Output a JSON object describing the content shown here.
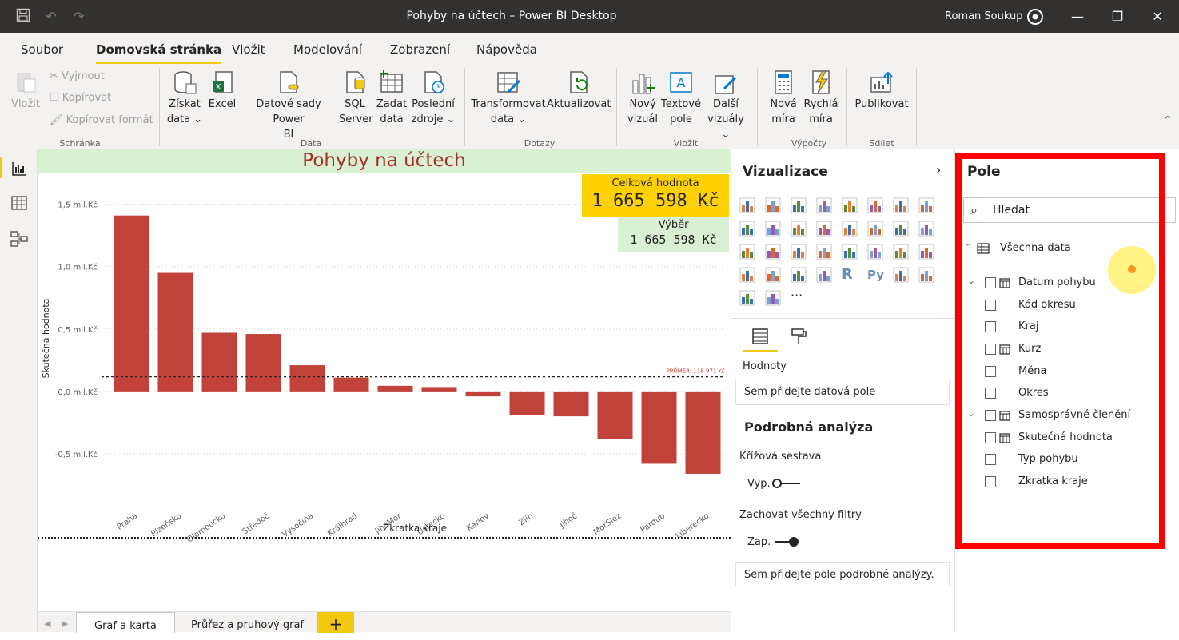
{
  "window": {
    "title": "Pohyby na účtech – Power BI Desktop",
    "user": "Roman Soukup"
  },
  "menu_tabs": [
    "Soubor",
    "Domovská stránka",
    "Vložit",
    "Modelování",
    "Zobrazení",
    "Nápověda"
  ],
  "ribbon": {
    "paste": "Vložit",
    "cut": "Vyjmout",
    "copy": "Kopírovat",
    "format_painter": "Kopírovat formát",
    "get_data_1": "Získat",
    "get_data_2": "data",
    "excel": "Excel",
    "datasets_1": "Datové sady Power",
    "datasets_2": "BI",
    "sql_1": "SQL",
    "sql_2": "Server",
    "enter_1": "Zadat",
    "enter_2": "data",
    "recent_1": "Poslední",
    "recent_2": "zdroje",
    "transform_1": "Transformovat",
    "transform_2": "data",
    "refresh": "Aktualizovat",
    "newvisual_1": "Nový",
    "newvisual_2": "vizuál",
    "textbox_1": "Textové",
    "textbox_2": "pole",
    "more_1": "Další",
    "more_2": "vizuály",
    "newmeasure_1": "Nová",
    "newmeasure_2": "míra",
    "quickmeasure_1": "Rychlá",
    "quickmeasure_2": "míra",
    "publish": "Publikovat",
    "groups": {
      "clipboard": "Schránka",
      "data": "Data",
      "queries": "Dotazy",
      "insert": "Vložit",
      "calc": "Výpočty",
      "share": "Sdílet"
    }
  },
  "report": {
    "title": "Pohyby na účtech",
    "card1_label": "Celková hodnota",
    "card1_value": "1 665 598 Kč",
    "card2_label": "Výběr",
    "card2_value": "1 665 598 Kč"
  },
  "chart_data": {
    "type": "bar",
    "xlabel": "Zkratka kraje",
    "ylabel": "Skutečná hodnota",
    "categories": [
      "Praha",
      "Plzeňsko",
      "Olomoucko",
      "Středoč",
      "Vysočina",
      "Králhrad",
      "JihoMor",
      "Ústecko",
      "Karlov",
      "Zlín",
      "Jihoč",
      "MorSlez",
      "Pardub",
      "Liberecko"
    ],
    "values": [
      1.41,
      0.95,
      0.47,
      0.46,
      0.21,
      0.11,
      0.045,
      0.035,
      -0.04,
      -0.19,
      -0.2,
      -0.38,
      -0.58,
      -0.66
    ],
    "ylim": [
      -0.75,
      1.6
    ],
    "yticks": [
      -0.5,
      0,
      0.5,
      1,
      1.5
    ],
    "ytick_labels": [
      "-0,5 mil.Kč",
      "0,0 mil.Kč",
      "0,5 mil.Kč",
      "1,0 mil.Kč",
      "1,5 mil.Kč"
    ],
    "average_value": 0.119,
    "average_label": "PRŮMĚR: 118 971 Kč",
    "bar_color": "#c0423a"
  },
  "page_tabs": [
    "Graf a karta",
    "Průřez a pruhový graf"
  ],
  "viz": {
    "title": "Vizualizace",
    "values_label": "Hodnoty",
    "values_drop": "Sem přidejte datová pole",
    "drill_title": "Podrobná analýza",
    "cross_report": "Křížová sestava",
    "toggle_off": "Vyp.",
    "keep_filters": "Zachovat všechny filtry",
    "toggle_on": "Zap.",
    "drill_drop": "Sem přidejte pole podrobné analýzy."
  },
  "fields": {
    "title": "Pole",
    "search_placeholder": "Hledat",
    "table": "Všechna data",
    "items": [
      "Datum pohybu",
      "Kód okresu",
      "Kraj",
      "Kurz",
      "Měna",
      "Okres",
      "Samosprávné členění",
      "Skutečná hodnota",
      "Typ pohybu",
      "Zkratka kraje"
    ]
  },
  "colors": {
    "accent": "#f2c811",
    "title_band": "#d9f0d3",
    "card1": "#ffd100",
    "card2": "#d9f0d3",
    "highlight": "#ff0000"
  }
}
